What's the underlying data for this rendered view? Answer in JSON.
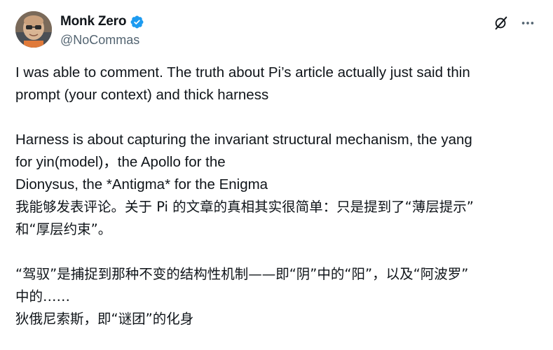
{
  "author": {
    "display_name": "Monk Zero",
    "handle": "@NoCommas",
    "verified": true,
    "avatar_icon": "avatar-photo",
    "verified_color": "#1d9bf0"
  },
  "actions": {
    "grok_icon": "grok-icon",
    "more_icon": "more-icon"
  },
  "tweet": {
    "en_lines": [
      "I was able to comment. The truth about Pi’s article actually just said thin",
      "prompt (your context) and thick harness",
      "Harness is about capturing  the invariant structural mechanism, the yang",
      "for yin(model)，the Apollo for the",
      "Dionysus, the *Antigma*  for the Enigma"
    ],
    "zh_lines": [
      "我能够发表评论。关于 Pi 的文章的真相其实很简单：只是提到了“薄层提示”",
      "和“厚层约束”。",
      "“驾驭”是捕捉到那种不变的结构性机制——即“阴”中的“阳”，以及“阿波罗”",
      "中的……",
      "狄俄尼索斯，即“谜团”的化身"
    ]
  }
}
